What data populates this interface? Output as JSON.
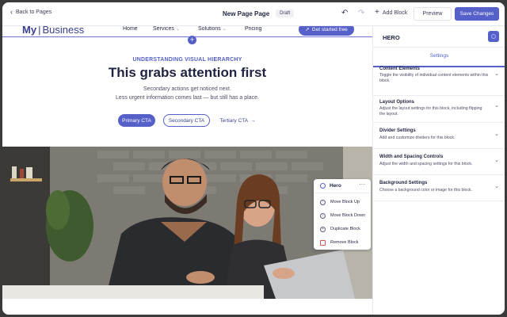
{
  "editor": {
    "back_label": "Back to Pages",
    "page_title": "New Page Page",
    "status_badge": "Draft",
    "add_block_label": "Add Block",
    "preview_label": "Preview",
    "save_label": "Save Changes"
  },
  "site": {
    "logo_my": "My",
    "logo_business": "Business",
    "nav": [
      {
        "label": "Home",
        "dropdown": false
      },
      {
        "label": "Services",
        "dropdown": true
      },
      {
        "label": "Solutions",
        "dropdown": true
      },
      {
        "label": "Pricing",
        "dropdown": false
      }
    ],
    "cta_label": "Get started free"
  },
  "hero": {
    "eyebrow": "UNDERSTANDING VISUAL HIERARCHY",
    "headline": "This grabs attention first",
    "sub_line1": "Secondary actions get noticed next.",
    "sub_line2": "Less urgent information comes last — but still has a place.",
    "primary_cta": "Primary CTA",
    "secondary_cta": "Secondary CTA",
    "tertiary_cta": "Tertiary CTA"
  },
  "context_menu": {
    "title": "Hero",
    "items": [
      {
        "label": "Move Block Up",
        "icon": "arrow-up-icon"
      },
      {
        "label": "Move Block Down",
        "icon": "arrow-down-icon"
      },
      {
        "label": "Duplicate Block",
        "icon": "duplicate-icon"
      },
      {
        "label": "Remove Block",
        "icon": "trash-icon"
      }
    ]
  },
  "sidebar": {
    "title": "HERO",
    "tab": "Settings",
    "sections": [
      {
        "title": "Content Elements",
        "desc": "Toggle the visibility of individual content elements within this block."
      },
      {
        "title": "Layout Options",
        "desc": "Adjust the layout settings for this block, including flipping the layout."
      },
      {
        "title": "Divider Settings",
        "desc": "Add and customize dividers for this block."
      },
      {
        "title": "Width and Spacing Controls",
        "desc": "Adjust the width and spacing settings for this block."
      },
      {
        "title": "Background Settings",
        "desc": "Choose a background color or image for this block."
      }
    ]
  },
  "colors": {
    "accent": "#5560c9",
    "text": "#1f2240"
  }
}
